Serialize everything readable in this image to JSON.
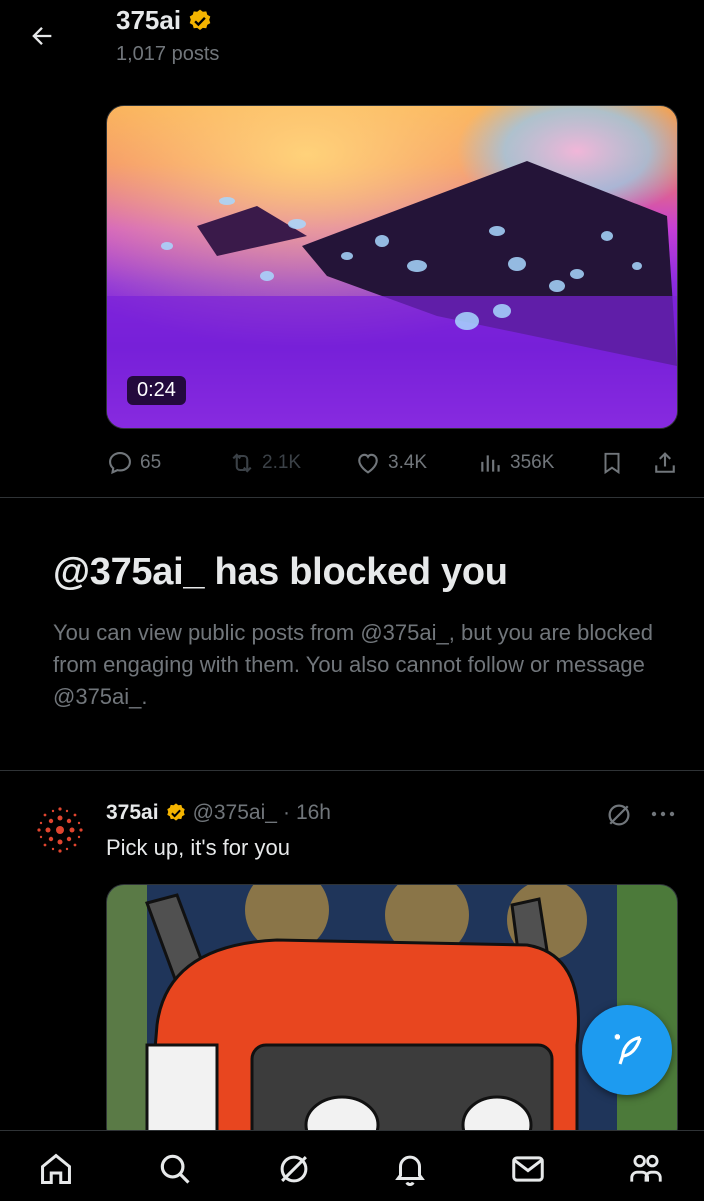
{
  "header": {
    "title": "375ai",
    "posts_count": "1,017 posts",
    "back_icon": "arrow-left-icon",
    "verified_icon": "gold-verified-badge-icon"
  },
  "video": {
    "duration": "0:24"
  },
  "actions": {
    "replies": "65",
    "reposts": "2.1K",
    "likes": "3.4K",
    "views": "356K",
    "icons": [
      "reply-icon",
      "repost-icon",
      "like-icon",
      "views-icon",
      "bookmark-icon",
      "share-icon"
    ]
  },
  "blocked": {
    "title": "@375ai_ has blocked you",
    "description": "You can view public posts from @375ai_, but you are blocked from engaging with them. You also cannot follow or message @375ai_."
  },
  "tweet": {
    "name": "375ai",
    "handle": "@375ai_",
    "dot": "·",
    "time": "16h",
    "text": "Pick up, it's for you"
  },
  "nav": {
    "items": [
      "home-icon",
      "search-icon",
      "grok-icon",
      "notifications-icon",
      "messages-icon",
      "communities-icon"
    ]
  },
  "colors": {
    "background": "#000000",
    "text_primary": "#e7e9ea",
    "text_secondary": "#71767b",
    "accent": "#1d9bf0",
    "verified_gold": "#f4b400",
    "divider": "#2f3336"
  }
}
